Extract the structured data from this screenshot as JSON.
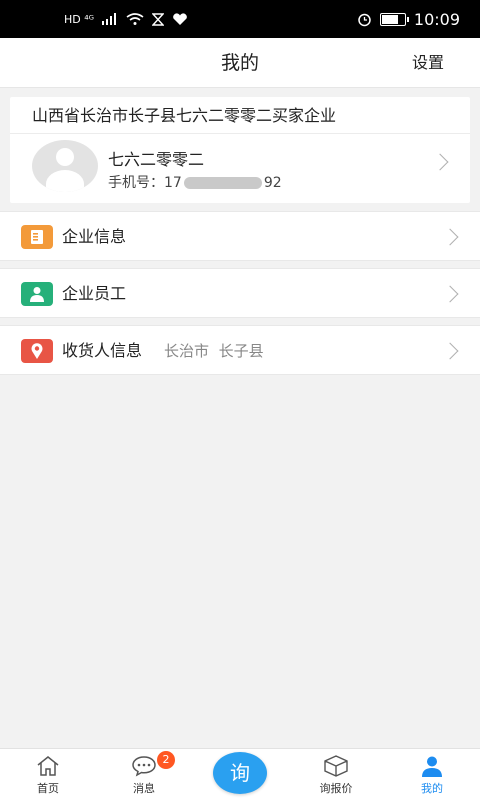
{
  "status_bar": {
    "left_icons": "HD ⁴ᴳ",
    "time": "10:09",
    "battery_level": 0.75
  },
  "nav": {
    "title": "我的",
    "settings_label": "设置"
  },
  "profile": {
    "company": "山西省长治市长子县七六二零零二买家企业",
    "user_name": "七六二零零二",
    "phone_prefix": "手机号：17",
    "phone_suffix": "92"
  },
  "menu": {
    "items": [
      {
        "label": "企业信息",
        "icon": "document-icon",
        "color": "#f39a3a"
      },
      {
        "label": "企业员工",
        "icon": "employee-icon",
        "color": "#26b07a"
      },
      {
        "label": "收货人信息",
        "icon": "location-pin-icon",
        "color": "#e85545",
        "city": "长治市",
        "county": "长子县"
      }
    ]
  },
  "tabbar": {
    "home": "首页",
    "messages": "消息",
    "messages_badge": "2",
    "inquiry": "询",
    "quote": "询报价",
    "mine": "我的",
    "active_color": "#1d8cf0"
  }
}
